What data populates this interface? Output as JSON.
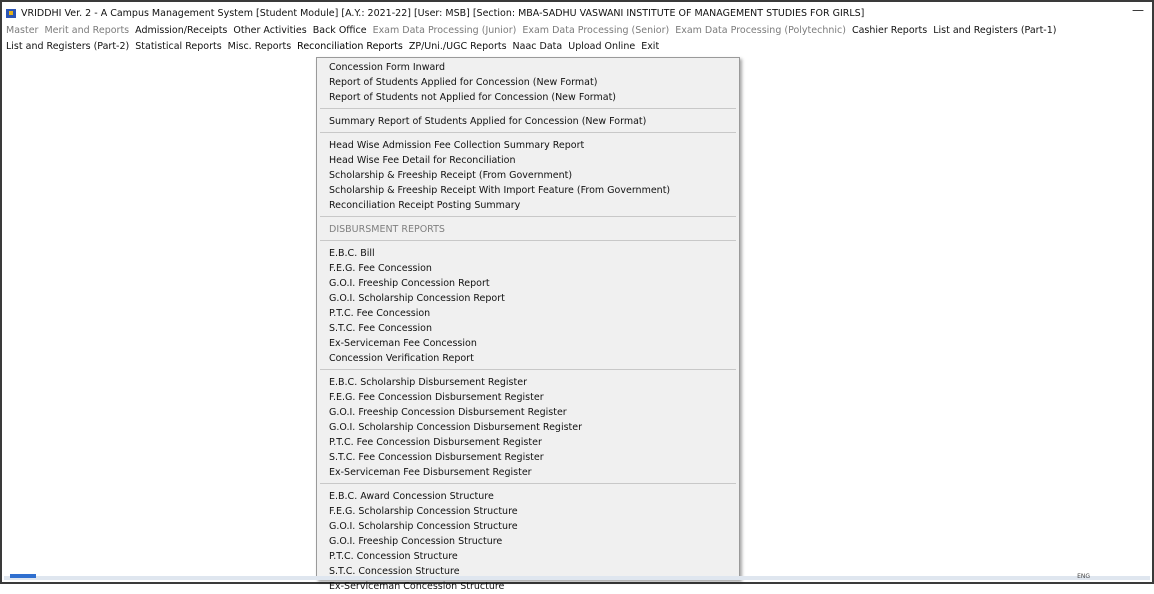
{
  "window": {
    "title": "VRIDDHI Ver. 2 - A Campus Management System [Student Module] [A.Y.: 2021-22] [User: MSB] [Section: MBA-SADHU VASWANI INSTITUTE OF MANAGEMENT STUDIES FOR GIRLS]",
    "minimize": "—"
  },
  "menubar": {
    "row1": [
      {
        "label": "Master",
        "dim": true
      },
      {
        "label": "Merit and Reports",
        "dim": true
      },
      {
        "label": "Admission/Receipts",
        "dim": false
      },
      {
        "label": "Other Activities",
        "dim": false
      },
      {
        "label": "Back Office",
        "dim": false
      },
      {
        "label": "Exam Data Processing (Junior)",
        "dim": true
      },
      {
        "label": "Exam Data Processing (Senior)",
        "dim": true
      },
      {
        "label": "Exam Data Processing (Polytechnic)",
        "dim": true
      },
      {
        "label": "Cashier Reports",
        "dim": false
      },
      {
        "label": "List and Registers (Part-1)",
        "dim": false
      }
    ],
    "row2": [
      {
        "label": "List and Registers (Part-2)",
        "dim": false
      },
      {
        "label": "Statistical Reports",
        "dim": false
      },
      {
        "label": "Misc. Reports",
        "dim": false
      },
      {
        "label": "Reconciliation Reports",
        "dim": false
      },
      {
        "label": "ZP/Uni./UGC Reports",
        "dim": false
      },
      {
        "label": "Naac Data",
        "dim": false
      },
      {
        "label": "Upload Online",
        "dim": false
      },
      {
        "label": "Exit",
        "dim": false
      }
    ]
  },
  "dropdown": {
    "groups": [
      [
        "Concession Form Inward",
        "Report of Students Applied for Concession (New Format)",
        "Report of Students not Applied for Concession (New Format)"
      ],
      [
        "Summary Report of Students Applied for Concession (New Format)"
      ],
      [
        "Head Wise Admission Fee Collection Summary Report",
        "Head Wise Fee Detail for Reconciliation",
        "Scholarship & Freeship Receipt (From Government)",
        "Scholarship & Freeship Receipt With Import Feature (From Government)",
        "Reconciliation Receipt Posting Summary"
      ],
      [
        "DISBURSMENT REPORTS"
      ],
      [
        "E.B.C. Bill",
        "F.E.G. Fee Concession",
        "G.O.I. Freeship Concession Report",
        "G.O.I. Scholarship Concession Report",
        "P.T.C. Fee Concession",
        "S.T.C. Fee Concession",
        "Ex-Serviceman Fee Concession",
        "Concession Verification Report"
      ],
      [
        "E.B.C. Scholarship Disbursement Register",
        "F.E.G. Fee Concession Disbursement Register",
        "G.O.I. Freeship Concession Disbursement Register",
        "G.O.I. Scholarship Concession Disbursement Register",
        "P.T.C. Fee Concession Disbursement Register",
        "S.T.C. Fee Concession Disbursement Register",
        "Ex-Serviceman Fee Disbursement Register"
      ],
      [
        "E.B.C. Award Concession Structure",
        "F.E.G. Scholarship Concession Structure",
        "G.O.I. Scholarship Concession Structure",
        "G.O.I. Freeship Concession Structure",
        "P.T.C. Concession Structure",
        "S.T.C. Concession Structure",
        "Ex-Serviceman Concession Structure"
      ]
    ],
    "disabled": [
      "DISBURSMENT REPORTS"
    ]
  },
  "taskbar": {
    "lang": "ENG"
  }
}
